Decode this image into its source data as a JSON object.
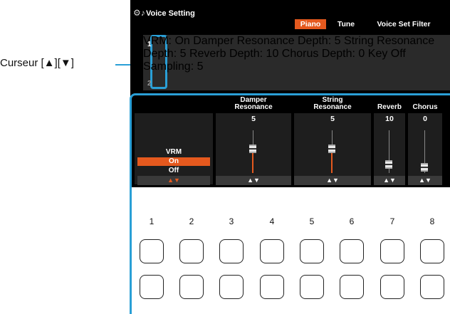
{
  "callout": "Curseur [▲][▼]",
  "header": {
    "title": "Voice Setting",
    "tabs": [
      {
        "label": "Piano",
        "active": true
      },
      {
        "label": "Tune",
        "active": false
      },
      {
        "label": "Voice Set Filter",
        "active": false
      }
    ]
  },
  "info": {
    "lines": [
      "VRM: On",
      "Damper Resonance Depth: 5",
      "String Resonance Depth: 5",
      "Reverb Depth: 10",
      "Key Off Sampling: 5"
    ],
    "chorus_line": "Chorus Depth: 0",
    "row_numbers": [
      "1",
      "2"
    ]
  },
  "controls": {
    "vrm": {
      "label": "VRM",
      "options": [
        "On",
        "Off"
      ],
      "selected": "On",
      "arrows": "▲▼"
    },
    "damper": {
      "label1": "Damper",
      "label2": "Resonance",
      "value": "5",
      "level": 0.5,
      "arrows": "▲▼"
    },
    "string": {
      "label1": "String",
      "label2": "Resonance",
      "value": "5",
      "level": 0.5,
      "arrows": "▲▼"
    },
    "reverb": {
      "label": "Reverb",
      "value": "10",
      "level": 0.1,
      "arrows": "▲▼"
    },
    "chorus": {
      "label": "Chorus",
      "value": "0",
      "level": 0.0,
      "arrows": "▲▼"
    }
  },
  "buttons": {
    "numbers": [
      "1",
      "2",
      "3",
      "4",
      "5",
      "6",
      "7",
      "8"
    ]
  },
  "colors": {
    "accent": "#e5591e",
    "highlight": "#2a9fd6"
  }
}
